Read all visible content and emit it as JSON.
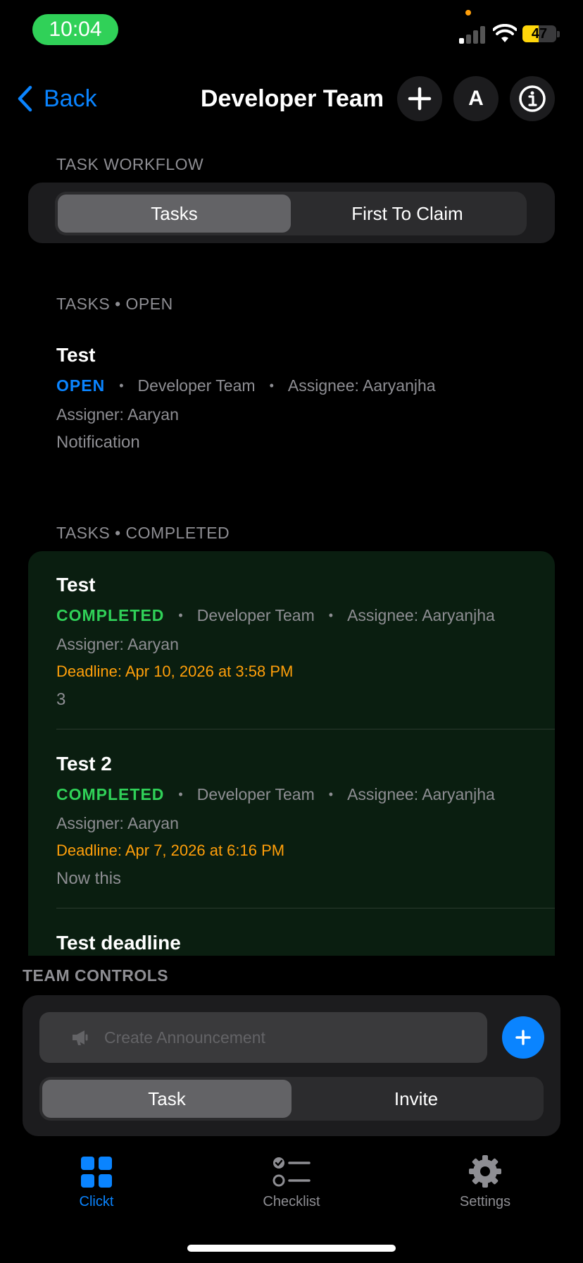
{
  "status_bar": {
    "time": "10:04",
    "battery_level": "47",
    "battery_fraction": 0.47
  },
  "nav": {
    "back_label": "Back",
    "title": "Developer Team",
    "avatar_initial": "A"
  },
  "workflow": {
    "header": "TASK WORKFLOW",
    "options": [
      "Tasks",
      "First To Claim"
    ],
    "selected": "Tasks"
  },
  "open_section": {
    "header": "TASKS • OPEN",
    "tasks": [
      {
        "title": "Test",
        "status": "OPEN",
        "team": "Developer Team",
        "assignee": "Assignee: Aaryanjha",
        "assigner": "Assigner: Aaryan",
        "description": "Notification"
      }
    ]
  },
  "completed_section": {
    "header": "TASKS • COMPLETED",
    "tasks": [
      {
        "title": "Test",
        "status": "COMPLETED",
        "team": "Developer Team",
        "assignee": "Assignee: Aaryanjha",
        "assigner": "Assigner: Aaryan",
        "deadline": "Deadline: Apr 10, 2026 at 3:58 PM",
        "description": "3"
      },
      {
        "title": "Test 2",
        "status": "COMPLETED",
        "team": "Developer Team",
        "assignee": "Assignee: Aaryanjha",
        "assigner": "Assigner: Aaryan",
        "deadline": "Deadline: Apr 7, 2026 at 6:16 PM",
        "description": "Now this"
      },
      {
        "title": "Test deadline"
      }
    ]
  },
  "team_controls": {
    "header": "TEAM CONTROLS",
    "announcement_placeholder": "Create Announcement",
    "modes": [
      "Task",
      "Invite"
    ],
    "selected": "Task"
  },
  "tabbar": {
    "items": [
      {
        "label": "Clickt",
        "icon": "grid-icon",
        "active": true
      },
      {
        "label": "Checklist",
        "icon": "checklist-icon",
        "active": false
      },
      {
        "label": "Settings",
        "icon": "gear-icon",
        "active": false
      }
    ]
  },
  "colors": {
    "accent": "#0a84ff",
    "completed": "#30d158",
    "deadline": "#ff9f0a",
    "completed_bg": "#0a1e10"
  }
}
